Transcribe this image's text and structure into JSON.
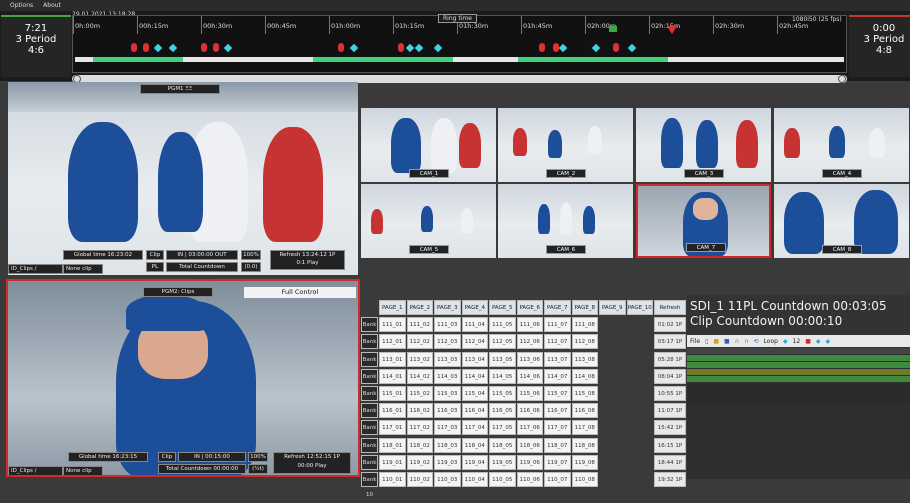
{
  "menu": {
    "options": "Options",
    "about": "About"
  },
  "timeline": {
    "date_time": "29.01.2021 13:18:28",
    "ring_time": "Ring time",
    "resolution": "1080i50 (25 fps)",
    "ticks": [
      "0h:00m",
      "00h:15m",
      "00h:30m",
      "00h:45m",
      "01h:00m",
      "01h:15m",
      "01h:30m",
      "01h:45m",
      "02h:00m",
      "02h:15m",
      "02h:30m",
      "02h:45m"
    ]
  },
  "left_counter": {
    "time": "7:21",
    "period": "3 Period",
    "score": "4:6"
  },
  "right_counter": {
    "time": "0:00",
    "period": "3 Period",
    "score": "4:8"
  },
  "main_player": {
    "tag": "PGM1    ΞΞ",
    "global_time": "Global time  16:23:02",
    "clip": "Clip",
    "clip_time": "IN  | 03:00:00  OUT",
    "zoom": "100%",
    "pl": "PL",
    "total_countdown": "Total Countdown 00:00:00",
    "rate": "(0.0)",
    "refresh": "Refresh 13:24:12  1P",
    "refresh2": "0:1 Play",
    "path": "ID_Clips / Cam_None",
    "no_clip": "None clip"
  },
  "detail_player": {
    "tag": "PGM2:   Clips",
    "full_control": "Full Control",
    "global_time": "Global time  16:23:15",
    "clip": "Clip",
    "clip_time": "IN  | 00:15:00",
    "zoom": "100%",
    "total_countdown": "Total Countdown 00:00:00",
    "rate": "(¼t)",
    "refresh": "Refresh 12:52:15  1P",
    "refresh2": "00:00 Play",
    "path": "ID_Clips / Cam_None",
    "no_clip": "None clip"
  },
  "cameras": [
    "CAM_1",
    "CAM_2",
    "CAM_3",
    "CAM_4",
    "CAM_5",
    "CAM_6",
    "CAM_7",
    "CAM_8"
  ],
  "pages": {
    "headers": [
      "PAGE_1",
      "PAGE_2",
      "PAGE_3",
      "PAGE_4",
      "PAGE_5",
      "PAGE_6",
      "PAGE_7",
      "PAGE_8",
      "PAGE_9",
      "PAGE_10"
    ],
    "refresh_header": "Refresh Data",
    "rows": [
      {
        "bank": "Bank 1",
        "cells": [
          "111_01",
          "111_02",
          "111_03",
          "111_04",
          "111_05",
          "111_06",
          "111_07",
          "111_08"
        ],
        "refresh": "01:02  1P"
      },
      {
        "bank": "Bank 2",
        "cells": [
          "112_01",
          "112_02",
          "112_03",
          "112_04",
          "112_05",
          "112_06",
          "112_07",
          "112_08"
        ],
        "refresh": "03:17  1P"
      },
      {
        "bank": "Bank 3",
        "cells": [
          "113_01",
          "113_02",
          "113_03",
          "113_04",
          "113_05",
          "113_06",
          "113_07",
          "113_08"
        ],
        "refresh": "05:28  1P"
      },
      {
        "bank": "Bank 4",
        "cells": [
          "114_01",
          "114_02",
          "114_03",
          "114_04",
          "114_05",
          "114_06",
          "114_07",
          "114_08"
        ],
        "refresh": "08:04  1P"
      },
      {
        "bank": "Bank 5",
        "cells": [
          "115_01",
          "115_02",
          "115_03",
          "115_04",
          "115_05",
          "115_06",
          "115_07",
          "115_08"
        ],
        "refresh": "10:55  1P"
      },
      {
        "bank": "Bank 6",
        "cells": [
          "116_01",
          "116_02",
          "116_03",
          "116_04",
          "116_05",
          "116_06",
          "116_07",
          "116_08"
        ],
        "refresh": "11:07  1P"
      },
      {
        "bank": "Bank 7",
        "cells": [
          "117_01",
          "117_02",
          "117_03",
          "117_04",
          "117_05",
          "117_06",
          "117_07",
          "117_08"
        ],
        "refresh": "15:42  1P"
      },
      {
        "bank": "Bank 8",
        "cells": [
          "118_01",
          "118_02",
          "118_03",
          "118_04",
          "118_05",
          "118_06",
          "118_07",
          "118_08"
        ],
        "refresh": "16:15  1P"
      },
      {
        "bank": "Bank 9",
        "cells": [
          "119_01",
          "119_02",
          "119_03",
          "119_04",
          "119_05",
          "119_06",
          "119_07",
          "119_08"
        ],
        "refresh": "18:44  1P"
      },
      {
        "bank": "Bank 10",
        "cells": [
          "110_01",
          "110_02",
          "110_03",
          "110_04",
          "110_05",
          "110_06",
          "110_07",
          "110_08"
        ],
        "refresh": "19:32  1P"
      }
    ]
  },
  "sdi": {
    "line1": "SDI_1  11PL  Countdown  00:03:05",
    "line2": "Clip  Countdown  00:00:10",
    "toolbar": {
      "file": "File",
      "loop": "Loop",
      "count": "12"
    },
    "colors": {
      "green": "#3f8a3f",
      "olive": "#6f7a2a",
      "dark": "#2a2a2a"
    }
  }
}
